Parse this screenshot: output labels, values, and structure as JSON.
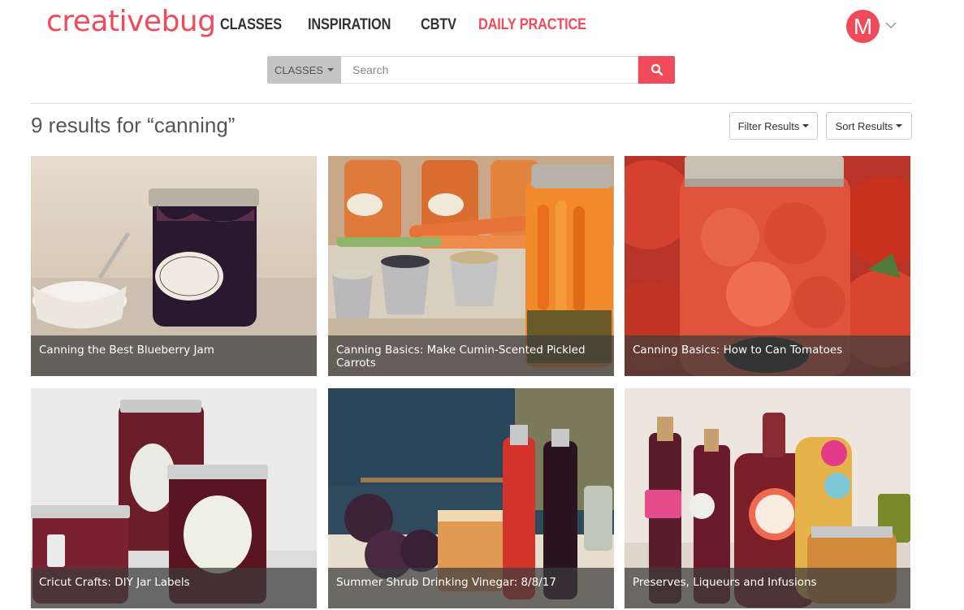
{
  "brand": {
    "logo_text": "creativebug",
    "accent": "#ef4b5a"
  },
  "nav": {
    "items": [
      {
        "label": "CLASSES"
      },
      {
        "label": "INSPIRATION"
      },
      {
        "label": "CBTV"
      },
      {
        "label": "DAILY PRACTICE"
      }
    ],
    "active": "DAILY PRACTICE"
  },
  "user": {
    "avatar_letter": "M"
  },
  "search": {
    "category_label": "CLASSES",
    "placeholder": "Search",
    "value": ""
  },
  "results": {
    "heading": "9 results for “canning”"
  },
  "toolbar": {
    "filter_label": "Filter Results",
    "sort_label": "Sort Results"
  },
  "cards": [
    {
      "title": "Canning the Best Blueberry Jam"
    },
    {
      "title": "Canning Basics: Make Cumin-Scented Pickled Carrots"
    },
    {
      "title": "Canning Basics: How to Can Tomatoes"
    },
    {
      "title": "Cricut Crafts: DIY Jar Labels"
    },
    {
      "title": "Summer Shrub Drinking Vinegar: 8/8/17"
    },
    {
      "title": "Preserves, Liqueurs and Infusions"
    }
  ]
}
